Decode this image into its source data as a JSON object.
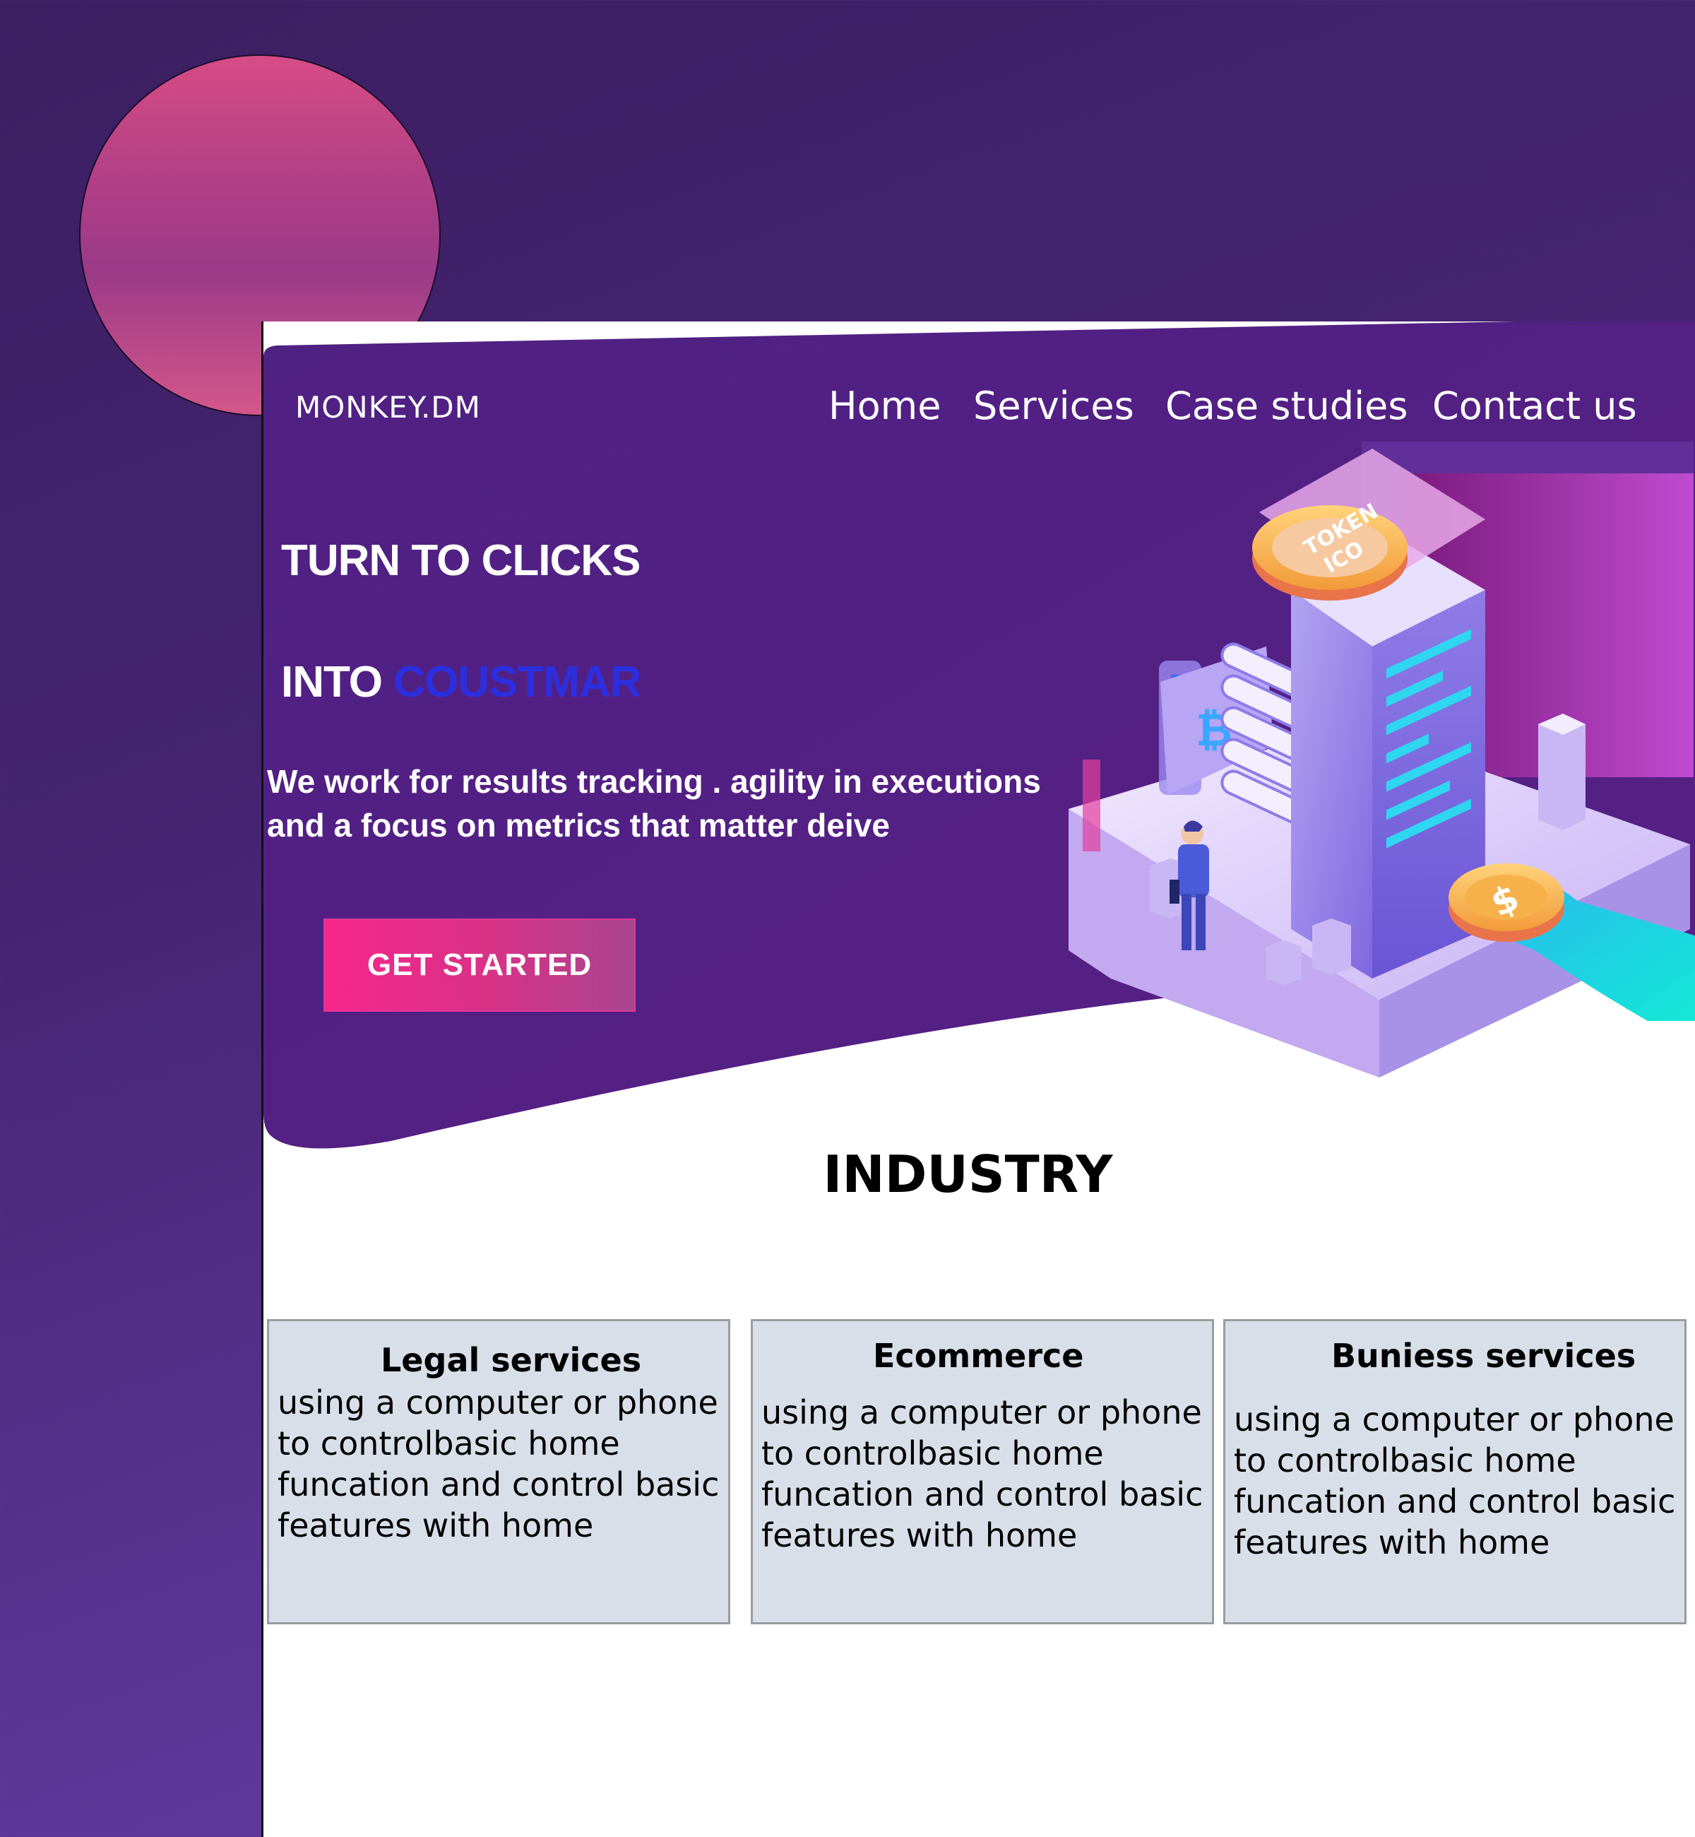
{
  "brand": {
    "logo": "MONKEY.DM"
  },
  "nav": {
    "items": [
      {
        "label": "Home"
      },
      {
        "label": "Services"
      },
      {
        "label": "Case studies"
      },
      {
        "label": "Contact us"
      }
    ]
  },
  "hero": {
    "title_line1": "TURN TO CLICKS",
    "title_line2_prefix": "INTO ",
    "title_line2_highlight": "COUSTMAR",
    "description": "We work for results tracking . agility in executions and a focus on metrics that matter deive",
    "cta_label": "GET STARTED",
    "illustration": {
      "coin_top_text_1": "TOKEN",
      "coin_top_text_2": "ICO",
      "bitcoin_symbol": "₿",
      "dollar_symbol": "$"
    }
  },
  "industry": {
    "title": "INDUSTRY",
    "cards": [
      {
        "title": "Legal services",
        "description": "using a computer or phone to controlbasic home funcation and control basic features with home"
      },
      {
        "title": "Ecommerce",
        "description": "using a computer or phone to controlbasic home funcation and control basic features with home"
      },
      {
        "title": "Buniess services",
        "description": "using a computer or phone to controlbasic home funcation and control basic features with home"
      }
    ]
  },
  "colors": {
    "page_bg": "#45236f",
    "hero_bg": "#52217f",
    "highlight": "#2b2fe0",
    "cta": "#f7268b",
    "card_bg": "#d9dfe8",
    "circle": "#d74c86"
  }
}
